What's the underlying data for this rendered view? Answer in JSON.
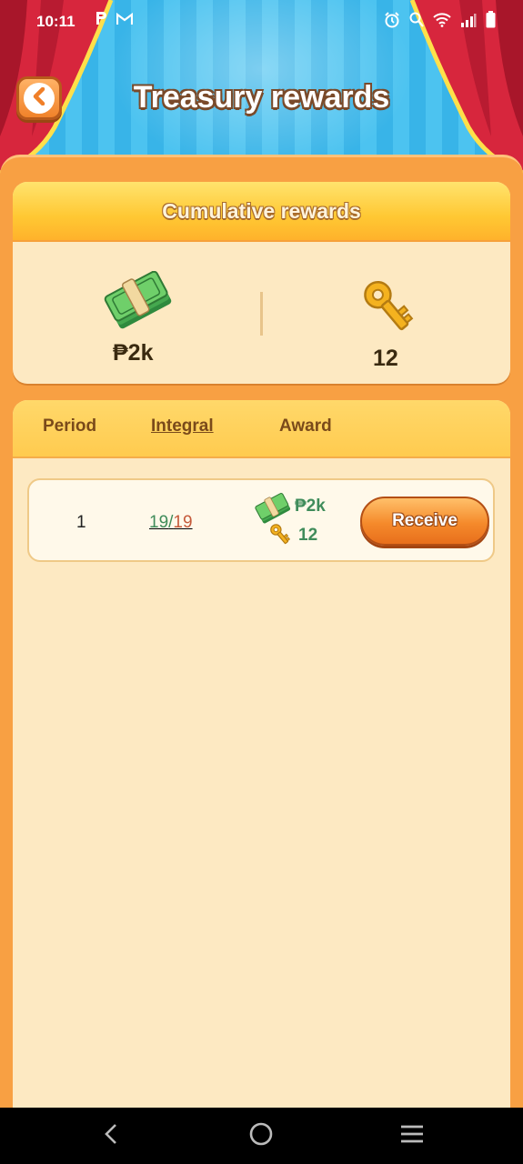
{
  "status_bar": {
    "time": "10:11",
    "left_icons": [
      "p-icon",
      "gmail-icon"
    ],
    "right_icons": [
      "alarm-icon",
      "search-icon",
      "wifi-icon",
      "signal-icon",
      "battery-icon"
    ]
  },
  "header": {
    "title": "Treasury rewards",
    "back_icon": "chevron-left-icon"
  },
  "summary": {
    "title": "Cumulative rewards",
    "money_value": "₱2k",
    "key_value": "12"
  },
  "list": {
    "columns": {
      "period": "Period",
      "integral": "Integral",
      "award": "Award"
    },
    "rows": [
      {
        "period": "1",
        "integral_current": "19",
        "integral_sep": "/",
        "integral_total": "19",
        "award_money": "₱2k",
        "award_keys": "12",
        "button_label": "Receive"
      }
    ]
  },
  "colors": {
    "panel": "#f8a043",
    "card": "#fde9c2",
    "award_text": "#3f8c5a",
    "integral_total": "#c55a3a",
    "button": "#f58a2b"
  },
  "navbar": {
    "icons": [
      "back-nav-icon",
      "home-nav-icon",
      "recents-nav-icon"
    ]
  }
}
